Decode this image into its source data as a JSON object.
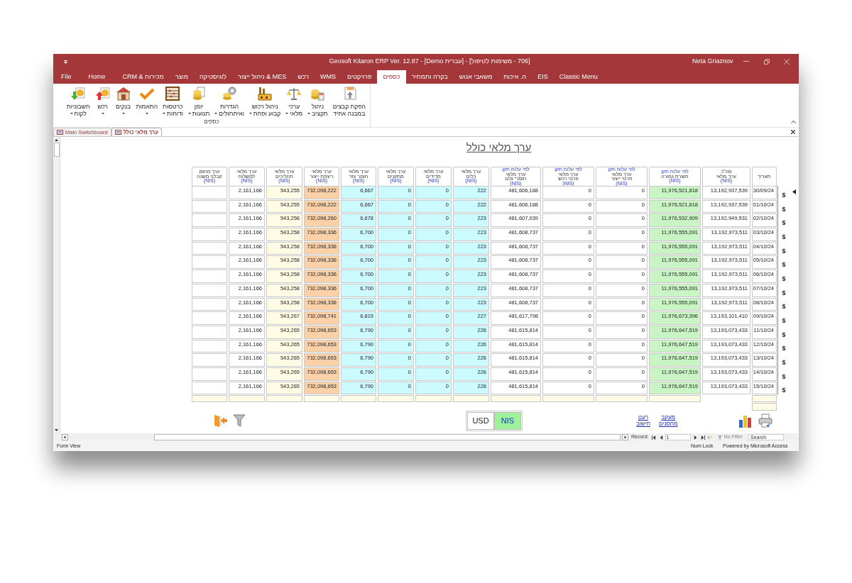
{
  "window": {
    "title": "Geosoft Kitaron ERP Ver. 12.87 - [Demo עברית] - [706 - משימות לטיפול]",
    "user": "Neta Griaznov"
  },
  "menu_tabs": [
    {
      "label": "Classic Menu",
      "selected": false
    },
    {
      "label": "EIS",
      "selected": false
    },
    {
      "label": "ה. איכות",
      "selected": false
    },
    {
      "label": "משאבי אנוש",
      "selected": false
    },
    {
      "label": "בקרה ותמחיר",
      "selected": false
    },
    {
      "label": "כספים",
      "selected": true
    },
    {
      "label": "פרויקטים",
      "selected": false
    },
    {
      "label": "WMS",
      "selected": false
    },
    {
      "label": "רכש",
      "selected": false
    },
    {
      "label": "ניהול ייצור & MES",
      "selected": false
    },
    {
      "label": "לוגיסטיקה",
      "selected": false
    },
    {
      "label": "מוצר",
      "selected": false
    },
    {
      "label": "CRM & מכירות",
      "selected": false
    },
    {
      "label": "Home",
      "selected": false
    },
    {
      "label": "File",
      "selected": false
    }
  ],
  "ribbon": {
    "group_label": "כספים",
    "buttons": [
      {
        "label": "הפקת קבצים\nבמבנה אחיד",
        "dropdown": false
      },
      {
        "label": "ניהול\nתקציב",
        "dropdown": true
      },
      {
        "label": "ערכי\nמלאי",
        "dropdown": true
      },
      {
        "label": "ניהול רכוש\nקבוע ופחת",
        "dropdown": true
      },
      {
        "label": "הגדרות\nואיתחולים",
        "dropdown": true
      },
      {
        "label": "יומן\nתנועות",
        "dropdown": true
      },
      {
        "label": "כרטסות\nודוחות",
        "dropdown": true
      },
      {
        "label": "התאמות",
        "dropdown": true
      },
      {
        "label": "בנקים",
        "dropdown": true
      },
      {
        "label": "רכש",
        "dropdown": true
      },
      {
        "label": "חשבוניות\nלקוח",
        "dropdown": true
      }
    ]
  },
  "document_tabs": [
    {
      "label": "Main Switchboard",
      "selected": false
    },
    {
      "label": "ערך מלאי כולל",
      "selected": true
    }
  ],
  "form": {
    "title": "ערך מלאי כולל",
    "columns": [
      {
        "title": "ערך מחסן\nקבלני משנה",
        "unit": "(NIS)",
        "color": "#ffffff"
      },
      {
        "title": "ערך מלאי\nלמשלוח",
        "unit": "(NIS)",
        "color": "#ffffff"
      },
      {
        "title": "ערך מלאי\nתהליכים",
        "unit": "(NIS)",
        "color": "#fffbe4"
      },
      {
        "title": "ערך מלאי\nריצפת ייצור",
        "unit": "(NIS)",
        "color": "#fcd1a8"
      },
      {
        "title": "ערך מלאי\nחומר עזר",
        "unit": "(NIS)",
        "color": "#ccfbff"
      },
      {
        "title": "ערך מלאי\nמתקנים",
        "unit": "(NIS)",
        "color": "#ccfbff"
      },
      {
        "title": "ערך מלאי\nמדידים",
        "unit": "(NIS)",
        "color": "#ccfbff"
      },
      {
        "title": "ערך מלאי\nכלים",
        "unit": "(NIS)",
        "color": "#ccfbff"
      },
      {
        "note": "לפי עלות תקן",
        "title": "ערך מלאי\nחומרי גלם",
        "unit": "(NIS)",
        "color": "#ffffff"
      },
      {
        "note": "לפי עלות תקן",
        "title": "ערך מלאי\nפרטי רכש",
        "unit": "(NIS)",
        "color": "#ffffff"
      },
      {
        "note": "לפי עלות תקן",
        "title": "ערך מלאי\nפרטי ייצור",
        "unit": "(NIS)",
        "color": "#ffffff"
      },
      {
        "note": "לפי עלות תקן",
        "title": "תוצרת גמורה",
        "unit": "(NIS)",
        "color": "#c9f5c4"
      },
      {
        "title": "סה\"כ\nערך מלאי",
        "unit": "(NIS)",
        "color": "#ffffff"
      },
      {
        "title": "תאריך",
        "color": "#ffffff"
      }
    ],
    "rows": [
      {
        "button": "$",
        "current": true,
        "cells": [
          null,
          "2,161,166",
          "543,255",
          "732,098,222",
          "6,667",
          "0",
          "0",
          "222",
          "481,606,188",
          "0",
          "0",
          "11,976,521,818",
          "13,192,937,539",
          "30/09/24"
        ]
      },
      {
        "button": "$",
        "current": false,
        "cells": [
          null,
          "2,161,166",
          "543,255",
          "732,098,222",
          "6,667",
          "0",
          "0",
          "222",
          "481,606,188",
          "0",
          "0",
          "11,976,521,818",
          "13,192,937,539",
          "01/10/24"
        ]
      },
      {
        "button": "$",
        "current": false,
        "cells": [
          null,
          "2,161,166",
          "543,256",
          "732,098,260",
          "6,678",
          "0",
          "0",
          "223",
          "481,607,039",
          "0",
          "0",
          "11,976,532,909",
          "13,192,949,531",
          "02/10/24"
        ]
      },
      {
        "button": "$",
        "current": false,
        "cells": [
          null,
          "2,161,166",
          "543,258",
          "732,098,336",
          "6,700",
          "0",
          "0",
          "223",
          "481,608,737",
          "0",
          "0",
          "11,976,555,091",
          "13,192,973,511",
          "03/10/24"
        ]
      },
      {
        "button": "$",
        "current": false,
        "cells": [
          null,
          "2,161,166",
          "543,258",
          "732,098,336",
          "6,700",
          "0",
          "0",
          "223",
          "481,608,737",
          "0",
          "0",
          "11,976,555,091",
          "13,192,973,511",
          "04/10/24"
        ]
      },
      {
        "button": "$",
        "current": false,
        "cells": [
          null,
          "2,161,166",
          "543,258",
          "732,098,336",
          "6,700",
          "0",
          "0",
          "223",
          "481,608,737",
          "0",
          "0",
          "11,976,555,091",
          "13,192,973,511",
          "05/10/24"
        ]
      },
      {
        "button": "$",
        "current": false,
        "cells": [
          null,
          "2,161,166",
          "543,258",
          "732,098,336",
          "6,700",
          "0",
          "0",
          "223",
          "481,608,737",
          "0",
          "0",
          "11,976,555,091",
          "13,192,973,511",
          "06/10/24"
        ]
      },
      {
        "button": "$",
        "current": false,
        "cells": [
          null,
          "2,161,166",
          "543,258",
          "732,098,336",
          "6,700",
          "0",
          "0",
          "223",
          "481,608,737",
          "0",
          "0",
          "11,976,555,091",
          "13,192,973,511",
          "07/10/24"
        ]
      },
      {
        "button": "$",
        "current": false,
        "cells": [
          null,
          "2,161,166",
          "543,258",
          "732,098,336",
          "6,700",
          "0",
          "0",
          "223",
          "481,608,737",
          "0",
          "0",
          "11,976,555,091",
          "13,192,973,511",
          "08/10/24"
        ]
      },
      {
        "button": "$",
        "current": false,
        "cells": [
          null,
          "2,161,166",
          "543,267",
          "732,098,741",
          "6,815",
          "0",
          "0",
          "227",
          "481,617,798",
          "0",
          "0",
          "11,976,673,396",
          "13,193,101,410",
          "09/10/24"
        ]
      },
      {
        "button": "$",
        "current": false,
        "cells": [
          null,
          "2,161,166",
          "543,265",
          "732,098,653",
          "6,790",
          "0",
          "0",
          "226",
          "481,615,814",
          "0",
          "0",
          "11,976,647,519",
          "13,193,073,433",
          "11/10/24"
        ]
      },
      {
        "button": "$",
        "current": false,
        "cells": [
          null,
          "2,161,166",
          "543,265",
          "732,098,653",
          "6,790",
          "0",
          "0",
          "226",
          "481,615,814",
          "0",
          "0",
          "11,976,647,519",
          "13,193,073,433",
          "12/10/24"
        ]
      },
      {
        "button": "$",
        "current": false,
        "cells": [
          null,
          "2,161,166",
          "543,265",
          "732,098,653",
          "6,790",
          "0",
          "0",
          "226",
          "481,615,814",
          "0",
          "0",
          "11,976,647,519",
          "13,193,073,433",
          "13/10/24"
        ]
      },
      {
        "button": "$",
        "current": false,
        "cells": [
          null,
          "2,161,166",
          "543,265",
          "732,098,653",
          "6,790",
          "0",
          "0",
          "226",
          "481,615,814",
          "0",
          "0",
          "11,976,647,519",
          "13,193,073,433",
          "14/10/24"
        ]
      },
      {
        "button": "$",
        "current": false,
        "cells": [
          null,
          "2,161,166",
          "543,265",
          "732,098,653",
          "6,790",
          "0",
          "0",
          "226",
          "481,615,814",
          "0",
          "0",
          "11,976,647,519",
          "13,193,073,433",
          "15/10/24"
        ]
      }
    ],
    "currency_toggle": [
      {
        "label": "USD",
        "selected": false
      },
      {
        "label": "NIS",
        "selected": true
      }
    ],
    "links": [
      "מעקב\nמחסנים",
      "רענן\nחישוב"
    ]
  },
  "navigation": {
    "record_label": "Record:",
    "record": "1",
    "filter": "No Filter",
    "search": "Search"
  },
  "status_bar": {
    "view": "Form View",
    "indicator": "Num Lock",
    "powered_by": "Powered by Microsoft Access"
  }
}
